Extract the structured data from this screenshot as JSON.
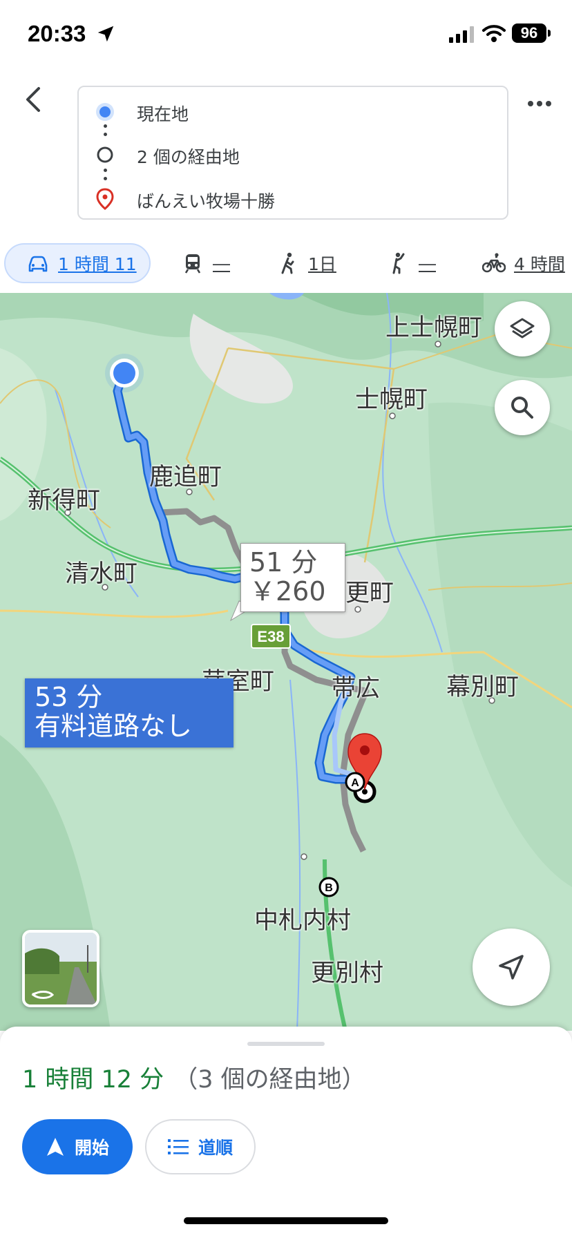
{
  "status_bar": {
    "time": "20:33",
    "battery": "96"
  },
  "route": {
    "origin": "現在地",
    "waypoints": "2 個の経由地",
    "destination": "ばんえい牧場十勝"
  },
  "modes": [
    {
      "icon": "car-icon",
      "label": "1 時間 11",
      "active": true
    },
    {
      "icon": "train-icon",
      "label": "―"
    },
    {
      "icon": "walk-icon",
      "label": "1日"
    },
    {
      "icon": "rideshare-icon",
      "label": "―"
    },
    {
      "icon": "bike-icon",
      "label": "4 時間"
    }
  ],
  "map": {
    "places": {
      "kamishihoro": "上士幌町",
      "shihoro": "士幌町",
      "shikaoi": "鹿追町",
      "shintoku": "新得町",
      "shimizu": "清水町",
      "sarabetsu_cho": "更町",
      "memuro": "芽室町",
      "obihiro": "帯広",
      "makubetsu": "幕別町",
      "nakasatsunai": "中札内村",
      "sarabetsu_mura": "更別村"
    },
    "highway_shield": "E38",
    "alt_route_callout": {
      "time": "51 分",
      "toll": "￥260"
    },
    "main_route_callout": {
      "time": "53 分",
      "note": "有料道路なし"
    },
    "waypoint_a": "A",
    "waypoint_b": "B"
  },
  "sheet": {
    "duration": "1 時間 12 分",
    "via": "（3 個の経由地）",
    "start_label": "開始",
    "steps_label": "道順"
  },
  "colors": {
    "accent": "#1a73e8",
    "route_primary": "#4285f4",
    "route_alt": "#9e9e9e",
    "duration_green": "#188038",
    "callout_blue": "#3a72d6"
  }
}
